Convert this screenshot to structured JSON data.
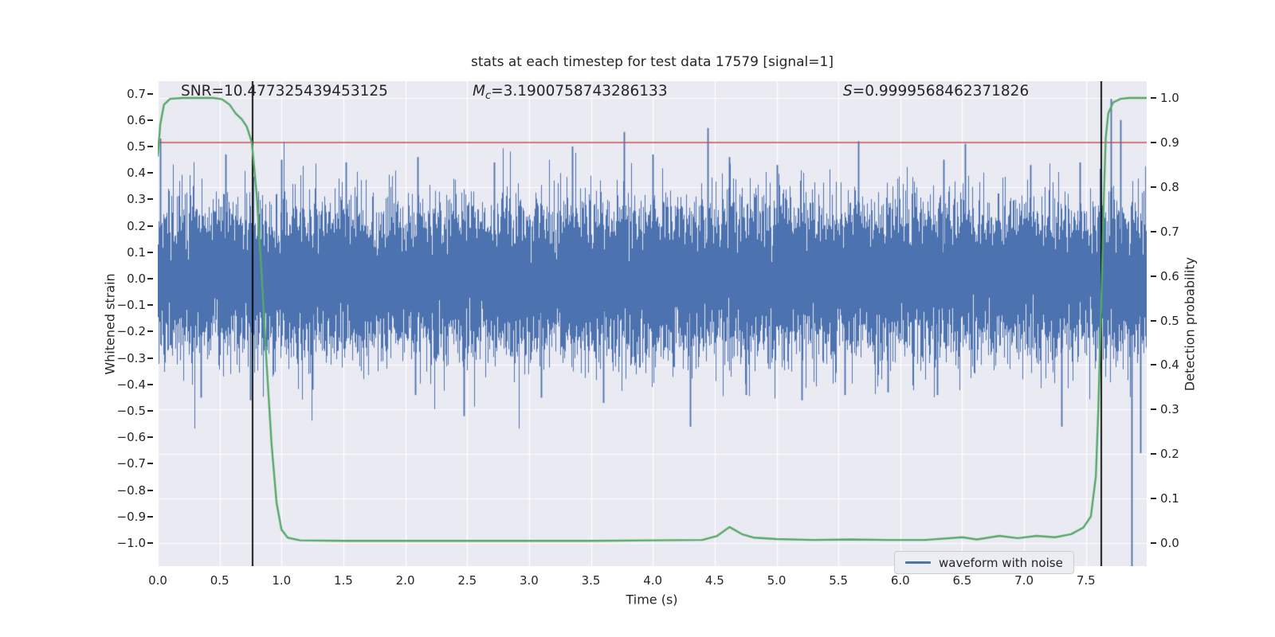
{
  "figure": {
    "title": "stats at each timestep for test data 17579 [signal=1]",
    "annotations": {
      "snr": {
        "label": "SNR",
        "value": "=10.477325439453125"
      },
      "mc": {
        "label": "M",
        "sub": "c",
        "value": "=3.1900758743286133"
      },
      "s": {
        "label": "S",
        "value": "=0.9999568462371826"
      }
    },
    "legend": {
      "label": "waveform with noise"
    }
  },
  "chart_data": {
    "type": "line",
    "title": "stats at each timestep for test data 17579 [signal=1]",
    "xlabel": "Time (s)",
    "ylabel_left": "Whitened strain",
    "ylabel_right": "Detection probability",
    "xlim": [
      0,
      7.99
    ],
    "ylim_left": [
      -1.087,
      0.747
    ],
    "ylim_right": [
      -0.052,
      1.037
    ],
    "grid": true,
    "background": "#EAEAF2",
    "gridline_color": "#FFFFFF",
    "x_ticks": [
      {
        "t": 0.0,
        "label": "0.0"
      },
      {
        "t": 0.5,
        "label": "0.5"
      },
      {
        "t": 1.0,
        "label": "1.0"
      },
      {
        "t": 1.5,
        "label": "1.5"
      },
      {
        "t": 2.0,
        "label": "2.0"
      },
      {
        "t": 2.5,
        "label": "2.5"
      },
      {
        "t": 3.0,
        "label": "3.0"
      },
      {
        "t": 3.5,
        "label": "3.5"
      },
      {
        "t": 4.0,
        "label": "4.0"
      },
      {
        "t": 4.5,
        "label": "4.5"
      },
      {
        "t": 5.0,
        "label": "5.0"
      },
      {
        "t": 5.5,
        "label": "5.5"
      },
      {
        "t": 6.0,
        "label": "6.0"
      },
      {
        "t": 6.5,
        "label": "6.5"
      },
      {
        "t": 7.0,
        "label": "7.0"
      },
      {
        "t": 7.5,
        "label": "7.5"
      }
    ],
    "y_ticks_left": [
      {
        "v": 0.7,
        "label": "0.7"
      },
      {
        "v": 0.6,
        "label": "0.6"
      },
      {
        "v": 0.5,
        "label": "0.5"
      },
      {
        "v": 0.4,
        "label": "0.4"
      },
      {
        "v": 0.3,
        "label": "0.3"
      },
      {
        "v": 0.2,
        "label": "0.2"
      },
      {
        "v": 0.1,
        "label": "0.1"
      },
      {
        "v": 0.0,
        "label": "0.0"
      },
      {
        "v": -0.1,
        "label": "−0.1"
      },
      {
        "v": -0.2,
        "label": "−0.2"
      },
      {
        "v": -0.3,
        "label": "−0.3"
      },
      {
        "v": -0.4,
        "label": "−0.4"
      },
      {
        "v": -0.5,
        "label": "−0.5"
      },
      {
        "v": -0.6,
        "label": "−0.6"
      },
      {
        "v": -0.7,
        "label": "−0.7"
      },
      {
        "v": -0.8,
        "label": "−0.8"
      },
      {
        "v": -0.9,
        "label": "−0.9"
      },
      {
        "v": -1.0,
        "label": "−1.0"
      }
    ],
    "y_ticks_right": [
      {
        "v": 1.0,
        "label": "1.0"
      },
      {
        "v": 0.9,
        "label": "0.9"
      },
      {
        "v": 0.8,
        "label": "0.8"
      },
      {
        "v": 0.7,
        "label": "0.7"
      },
      {
        "v": 0.6,
        "label": "0.6"
      },
      {
        "v": 0.5,
        "label": "0.5"
      },
      {
        "v": 0.4,
        "label": "0.4"
      },
      {
        "v": 0.3,
        "label": "0.3"
      },
      {
        "v": 0.2,
        "label": "0.2"
      },
      {
        "v": 0.1,
        "label": "0.1"
      },
      {
        "v": 0.0,
        "label": "0.0"
      }
    ],
    "threshold_line": {
      "axis": "right",
      "value": 0.9,
      "color": "#C44E52"
    },
    "vlines": [
      {
        "t": 0.766,
        "color": "#000000"
      },
      {
        "t": 7.624,
        "color": "#000000"
      }
    ],
    "series": [
      {
        "name": "waveform with noise",
        "axis": "left",
        "color": "#4C72B0",
        "style": "dense-noise",
        "noise_sigma": 0.135,
        "samples_per_column": 16,
        "seed": 1337,
        "core_band": 0.17,
        "spikes": [
          {
            "t": 0.02,
            "v": 0.53
          },
          {
            "t": 0.55,
            "v": 0.47
          },
          {
            "t": 1.0,
            "v": 0.45
          },
          {
            "t": 1.52,
            "v": 0.44
          },
          {
            "t": 2.1,
            "v": 0.46
          },
          {
            "t": 2.72,
            "v": 0.44
          },
          {
            "t": 3.35,
            "v": 0.5
          },
          {
            "t": 3.77,
            "v": 0.555
          },
          {
            "t": 4.0,
            "v": 0.47
          },
          {
            "t": 4.44,
            "v": 0.57
          },
          {
            "t": 4.62,
            "v": 0.46
          },
          {
            "t": 5.0,
            "v": 0.43
          },
          {
            "t": 5.66,
            "v": 0.52
          },
          {
            "t": 6.35,
            "v": 0.45
          },
          {
            "t": 6.52,
            "v": 0.51
          },
          {
            "t": 7.05,
            "v": 0.43
          },
          {
            "t": 7.45,
            "v": 0.44
          },
          {
            "t": 7.7,
            "v": 0.68
          },
          {
            "t": 7.78,
            "v": 0.6
          },
          {
            "t": 0.35,
            "v": -0.45
          },
          {
            "t": 0.75,
            "v": -0.46
          },
          {
            "t": 1.25,
            "v": -0.42
          },
          {
            "t": 2.08,
            "v": -0.44
          },
          {
            "t": 2.47,
            "v": -0.52
          },
          {
            "t": 3.1,
            "v": -0.45
          },
          {
            "t": 3.6,
            "v": -0.47
          },
          {
            "t": 4.3,
            "v": -0.56
          },
          {
            "t": 4.75,
            "v": -0.44
          },
          {
            "t": 5.2,
            "v": -0.46
          },
          {
            "t": 5.55,
            "v": -0.44
          },
          {
            "t": 5.9,
            "v": -0.43
          },
          {
            "t": 6.3,
            "v": -0.44
          },
          {
            "t": 7.3,
            "v": -0.56
          },
          {
            "t": 7.87,
            "v": -1.09
          },
          {
            "t": 7.94,
            "v": -0.66
          }
        ]
      },
      {
        "name": "detection probability",
        "axis": "right",
        "color": "#55A868",
        "style": "line",
        "points": [
          [
            0.0,
            0.87
          ],
          [
            0.02,
            0.94
          ],
          [
            0.05,
            0.985
          ],
          [
            0.1,
            0.998
          ],
          [
            0.2,
            1.0
          ],
          [
            0.45,
            1.0
          ],
          [
            0.52,
            0.997
          ],
          [
            0.58,
            0.985
          ],
          [
            0.63,
            0.965
          ],
          [
            0.68,
            0.952
          ],
          [
            0.72,
            0.935
          ],
          [
            0.76,
            0.9
          ],
          [
            0.8,
            0.78
          ],
          [
            0.84,
            0.6
          ],
          [
            0.88,
            0.4
          ],
          [
            0.92,
            0.22
          ],
          [
            0.96,
            0.09
          ],
          [
            1.0,
            0.03
          ],
          [
            1.05,
            0.012
          ],
          [
            1.15,
            0.006
          ],
          [
            1.5,
            0.005
          ],
          [
            2.0,
            0.005
          ],
          [
            2.5,
            0.005
          ],
          [
            3.0,
            0.005
          ],
          [
            3.5,
            0.005
          ],
          [
            4.0,
            0.006
          ],
          [
            4.4,
            0.007
          ],
          [
            4.52,
            0.016
          ],
          [
            4.62,
            0.036
          ],
          [
            4.72,
            0.02
          ],
          [
            4.82,
            0.012
          ],
          [
            5.0,
            0.009
          ],
          [
            5.3,
            0.007
          ],
          [
            5.6,
            0.008
          ],
          [
            5.9,
            0.007
          ],
          [
            6.2,
            0.007
          ],
          [
            6.5,
            0.013
          ],
          [
            6.62,
            0.008
          ],
          [
            6.8,
            0.016
          ],
          [
            6.95,
            0.011
          ],
          [
            7.1,
            0.016
          ],
          [
            7.25,
            0.013
          ],
          [
            7.38,
            0.02
          ],
          [
            7.48,
            0.035
          ],
          [
            7.54,
            0.06
          ],
          [
            7.58,
            0.15
          ],
          [
            7.6,
            0.3
          ],
          [
            7.625,
            0.55
          ],
          [
            7.645,
            0.78
          ],
          [
            7.66,
            0.91
          ],
          [
            7.68,
            0.965
          ],
          [
            7.72,
            0.99
          ],
          [
            7.78,
            0.998
          ],
          [
            7.85,
            1.0
          ],
          [
            7.99,
            1.0
          ]
        ]
      }
    ],
    "legend": {
      "entries": [
        "waveform with noise"
      ],
      "position": "lower right"
    }
  },
  "colors": {
    "waveform": "#4C72B0",
    "probability": "#55A868",
    "threshold": "#C44E52",
    "vline": "#000000",
    "plot_background": "#EAEAF2",
    "grid": "#FFFFFF",
    "text": "#262626"
  }
}
